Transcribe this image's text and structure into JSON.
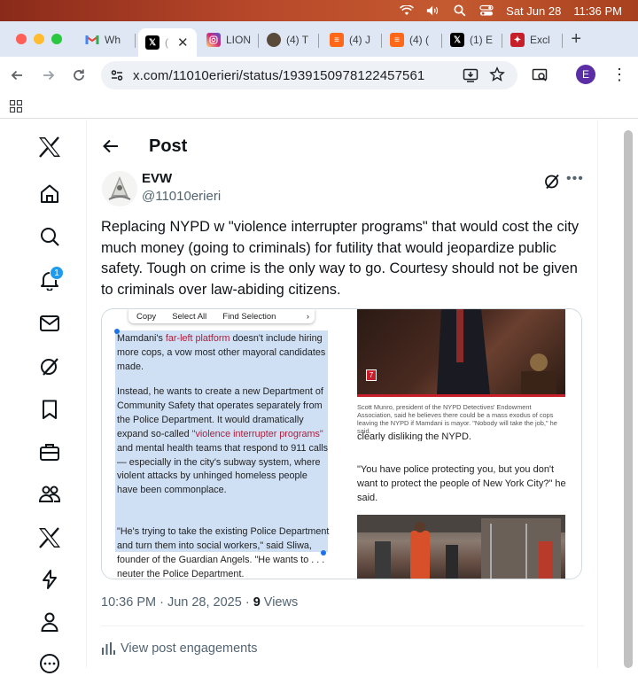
{
  "menubar": {
    "date": "Sat Jun 28",
    "time": "11:36 PM"
  },
  "tabs": [
    {
      "label": "Wh",
      "icon": "gmail-icon",
      "color": "#ea4335"
    },
    {
      "label": "(",
      "icon": "x-icon",
      "color": "#000000",
      "active": true
    },
    {
      "label": "LION",
      "icon": "instagram-icon",
      "color": "#d62976"
    },
    {
      "label": "(4) T",
      "icon": "podcast-icon",
      "color": "#5a4a3a"
    },
    {
      "label": "(4) J",
      "icon": "substack-icon",
      "color": "#ff6719"
    },
    {
      "label": "(4) (",
      "icon": "substack-icon",
      "color": "#ff6719"
    },
    {
      "label": "(1) E",
      "icon": "x-icon",
      "color": "#000000"
    },
    {
      "label": "Excl",
      "icon": "news-icon",
      "color": "#c61f2a"
    }
  ],
  "toolbar": {
    "url": "x.com/11010erieri/status/1939150978122457561",
    "profile_initial": "E"
  },
  "sidebar": {
    "notification_count": "1"
  },
  "post": {
    "header_title": "Post",
    "author_name": "EVW",
    "author_handle": "@11010erieri",
    "text": "Replacing NYPD w \"violence interrupter programs\" that would cost the city much money (going to criminals) for futility that would jeopardize public safety. Tough on crime is the only way to go. Courtesy should not be given to criminals over law-abiding citizens.",
    "timestamp": "10:36 PM · Jun 28, 2025 · ",
    "views_count": "9",
    "views_label": " Views",
    "engagements_label": "View post engagements"
  },
  "media": {
    "context_menu": [
      "Copy",
      "Select All",
      "Find Selection"
    ],
    "para1_a": "Mamdani's ",
    "para1_red": "far-left platform",
    "para1_b": " doesn't include hiring more cops, a vow most other mayoral candidates made.",
    "para2_a": "Instead, he wants to create a new Department of Community Safety that operates separately from the Police Department. It would dramatically expand so-called ",
    "para2_red": "\"violence interrupter programs\"",
    "para2_b": " and mental health teams that respond to 911 calls — especially in the city's subway system, where violent attacks by unhinged homeless people have been commonplace.",
    "para3": "\"He's trying to take the existing Police Department and turn them into social workers,\" said Sliwa, founder of the Guardian Angels. \"He wants to . . . neuter the Police Department.",
    "photo_logo": "7",
    "caption": "Scott Munro, president of the NYPD Detectives' Endowment Association, said he believes there could be a mass exodus of cops leaving the NYPD if Mamdani is mayor. \"Nobody will take the job,\" he said.",
    "right_partial": "clearly disliking the NYPD.",
    "right_quote": "\"You have police protecting you, but you don't want to protect the people of New York City?\" he said."
  }
}
